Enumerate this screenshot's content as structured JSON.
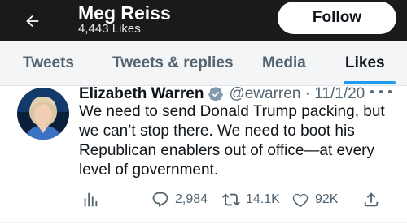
{
  "header": {
    "back_icon": "arrow-left-icon",
    "profile_name": "Meg Reiss",
    "likes_count": "4,443 Likes",
    "follow_label": "Follow",
    "background_color": "#1a1a1a"
  },
  "tabs": [
    {
      "label": "Tweets",
      "active": false
    },
    {
      "label": "Tweets & replies",
      "active": false
    },
    {
      "label": "Media",
      "active": false
    },
    {
      "label": "Likes",
      "active": true
    }
  ],
  "accent_color": "#1d9bf0",
  "tweet": {
    "author_name": "Elizabeth Warren",
    "verified_icon": "verified-badge-icon",
    "handle_date": "@ewarren · 11/1/20",
    "text": "We need to send Donald Trump packing, but we can’t stop there. We need to boot his Republican enablers out of office—at every level of government.",
    "actions": {
      "analytics_icon": "analytics-icon",
      "reply_count": "2,984",
      "retweet_count": "14.1K",
      "like_count": "92K",
      "share_icon": "share-icon"
    }
  }
}
